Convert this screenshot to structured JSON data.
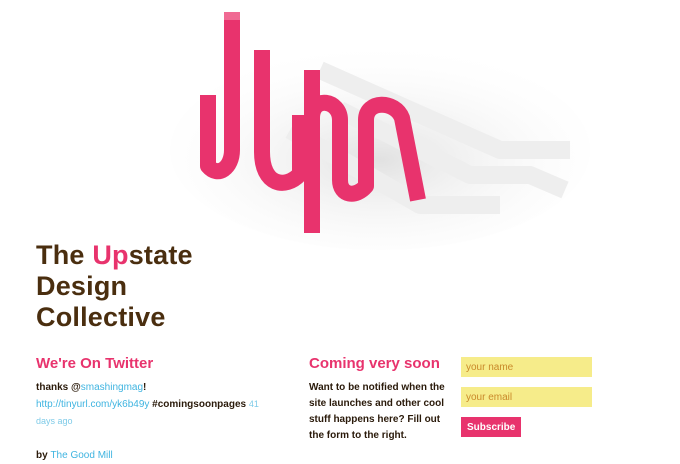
{
  "title": {
    "line1_pre": "The ",
    "line1_accent": "Up",
    "line1_post": "state",
    "line2": "Design",
    "line3": "Collective"
  },
  "twitter": {
    "heading": "We're On Twitter",
    "thanks_prefix": "thanks @",
    "handle": "smashingmag",
    "handle_suffix": "!",
    "link": "http://tinyurl.com/yk6b49y",
    "hashtag": "#comingsoonpages",
    "time_ago_a": "41",
    "time_ago_b": "days ago",
    "by_label": "by",
    "by_link": "The Good Mill"
  },
  "coming_soon": {
    "heading": "Coming very soon",
    "text": "Want to be notified when the site launches and other cool stuff happens here? Fill out the form to the right."
  },
  "form": {
    "name_placeholder": "your name",
    "email_placeholder": "your email",
    "subscribe_label": "Subscribe"
  },
  "colors": {
    "accent": "#e8336d",
    "title_brown": "#4a2e0f",
    "link_blue": "#3fb4e0",
    "input_yellow": "#f6ec8a"
  },
  "icons": [
    "udc-logo-mark"
  ]
}
